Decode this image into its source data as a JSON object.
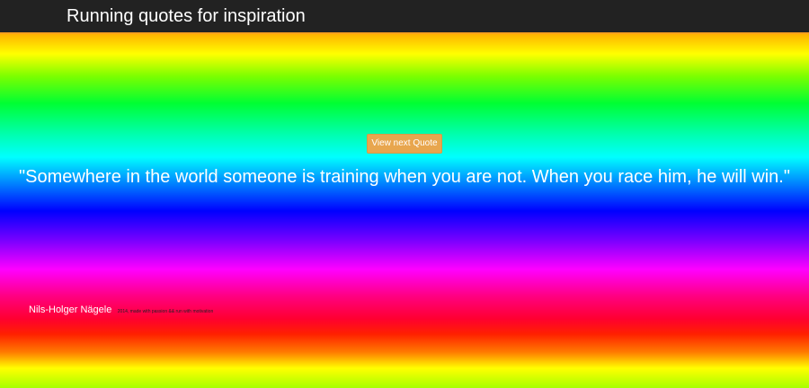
{
  "header": {
    "title": "Running quotes for inspiration"
  },
  "main": {
    "next_button_label": "View next Quote",
    "quote_text": "\"Somewhere in the world someone is training when you are not. When you race him, he will win.\""
  },
  "footer": {
    "author": "Nils-Holger Nägele",
    "copyright": "2014, made with passion && run with motivation"
  },
  "colors": {
    "topbar": "#222222",
    "accent_border": "#ffa11c",
    "button": "#e8a64e"
  }
}
